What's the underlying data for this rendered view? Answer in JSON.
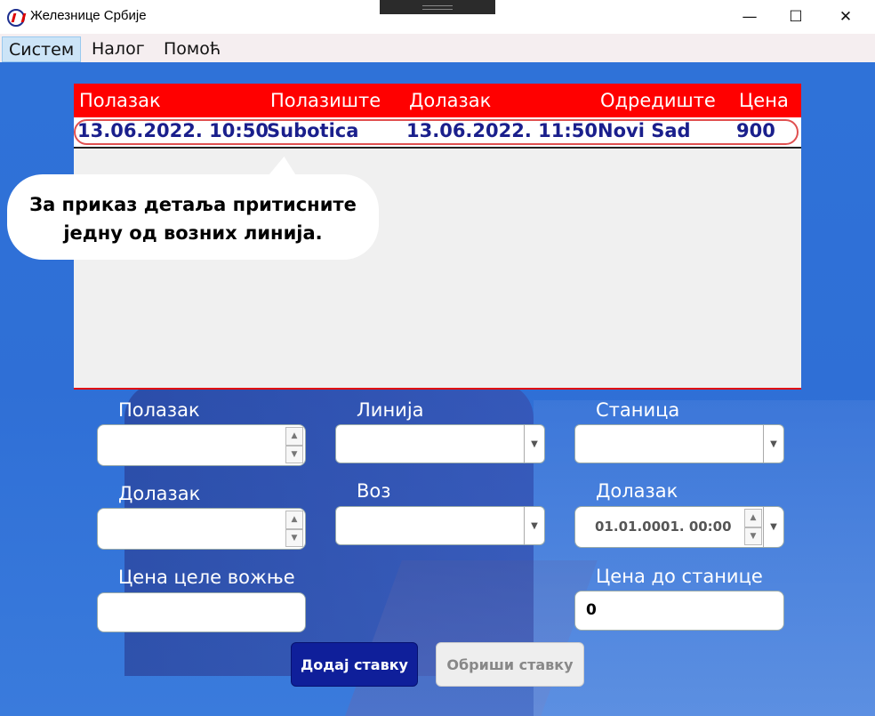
{
  "window": {
    "title": "Железнице Србије",
    "minimize": "—",
    "maximize": "☐",
    "close": "✕"
  },
  "menu": {
    "items": [
      {
        "label": "Систем"
      },
      {
        "label": "Налог"
      },
      {
        "label": "Помоћ"
      }
    ]
  },
  "table": {
    "headers": [
      "Полазак",
      "Полазиште",
      "Долазак",
      "Одредиште",
      "Цена"
    ],
    "rows": [
      [
        "13.06.2022. 10:50",
        "Subotica",
        "13.06.2022. 11:50",
        "Novi Sad",
        "900"
      ]
    ]
  },
  "tooltip": {
    "line1": "За приказ детаља притисните",
    "line2": "једну од возних линија."
  },
  "form": {
    "departure_label": "Полазак",
    "arrival_label": "Долазак",
    "price_full_label": "Цена целе вожње",
    "line_label": "Линија",
    "train_label": "Воз",
    "station_label": "Станица",
    "station_arrival_label": "Долазак",
    "station_arrival_value": "01.01.0001. 00:00",
    "price_station_label": "Цена до станице",
    "price_station_value": "0"
  },
  "buttons": {
    "add": "Додај ставку",
    "delete": "Обриши ставку"
  },
  "colors": {
    "header_red": "#ff0000",
    "row_text": "#1a1f8c",
    "add_button": "#0f1f9a",
    "background_blue": "#2f72d8"
  }
}
